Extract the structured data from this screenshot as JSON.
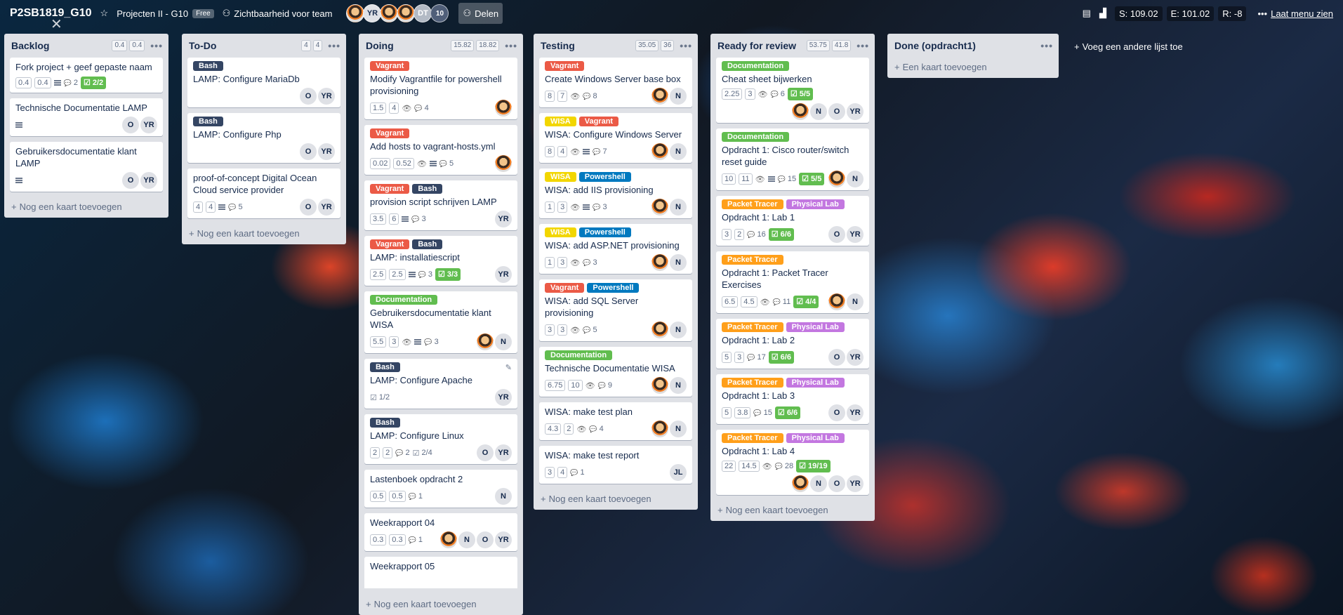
{
  "header": {
    "board_name": "P2SB1819_G10",
    "team": "Projecten II - G10",
    "free_badge": "Free",
    "visibility": "Zichtbaarheid voor team",
    "avatars": [
      "YR",
      "DT",
      "10"
    ],
    "share": "Delen",
    "stats": {
      "s": "S: 109.02",
      "e": "E: 101.02",
      "r": "R: -8"
    },
    "menu": "Laat menu zien"
  },
  "add_list": "Voeg een andere lijst toe",
  "add_card": "Nog een kaart toevoegen",
  "add_card_first": "Een kaart toevoegen",
  "colors": {
    "vagrant": "#eb5a46",
    "bash": "#344563",
    "documentation": "#61bd4f",
    "wisa": "#f2d600",
    "powershell": "#0079bf",
    "packet_tracer": "#ff9f1a",
    "physical_lab": "#c377e0"
  },
  "lists": [
    {
      "title": "Backlog",
      "est": [
        "0.4",
        "0.4"
      ],
      "cards": [
        {
          "labels": [],
          "title": "Fork project + geef gepaste naam",
          "nums": [
            "0.4",
            "0.4"
          ],
          "desc": true,
          "comments": "2",
          "check": "2/2",
          "members": []
        },
        {
          "labels": [],
          "title": "Technische Documentatie LAMP",
          "nums": [],
          "desc": true,
          "members": [
            "O",
            "YR"
          ]
        },
        {
          "labels": [],
          "title": "Gebruikersdocumentatie klant LAMP",
          "nums": [],
          "desc": true,
          "members": [
            "O",
            "YR"
          ]
        }
      ]
    },
    {
      "title": "To-Do",
      "est": [
        "4",
        "4"
      ],
      "cards": [
        {
          "labels": [
            "Bash"
          ],
          "title": "LAMP: Configure MariaDb",
          "nums": [],
          "members": [
            "O",
            "YR"
          ]
        },
        {
          "labels": [
            "Bash"
          ],
          "title": "LAMP: Configure Php",
          "nums": [],
          "members": [
            "O",
            "YR"
          ]
        },
        {
          "labels": [],
          "title": "proof-of-concept Digital Ocean Cloud service provider",
          "nums": [
            "4",
            "4"
          ],
          "desc": true,
          "comments": "5",
          "members": [
            "O",
            "YR"
          ]
        }
      ]
    },
    {
      "title": "Doing",
      "est": [
        "15.82",
        "18.82"
      ],
      "cards": [
        {
          "labels": [
            "Vagrant"
          ],
          "title": "Modify Vagrantfile for powershell provisioning",
          "nums": [
            "1.5",
            "4"
          ],
          "watch": true,
          "comments": "4",
          "members": [
            "photo"
          ]
        },
        {
          "labels": [
            "Vagrant"
          ],
          "title": "Add hosts to vagrant-hosts.yml",
          "nums": [
            "0.02",
            "0.52"
          ],
          "watch": true,
          "desc": true,
          "comments": "5",
          "members": [
            "photo"
          ]
        },
        {
          "labels": [
            "Vagrant",
            "Bash"
          ],
          "title": "provision script schrijven LAMP",
          "nums": [
            "3.5",
            "6"
          ],
          "desc": true,
          "comments": "3",
          "members": [
            "YR"
          ]
        },
        {
          "labels": [
            "Vagrant",
            "Bash"
          ],
          "title": "LAMP: installatiescript",
          "nums": [
            "2.5",
            "2.5"
          ],
          "desc": true,
          "comments": "3",
          "check": "3/3",
          "members": [
            "YR"
          ]
        },
        {
          "labels": [
            "Documentation"
          ],
          "title": "Gebruikersdocumentatie klant WISA",
          "nums": [
            "5.5",
            "3"
          ],
          "watch": true,
          "desc": true,
          "comments": "3",
          "members": [
            "photo",
            "N"
          ]
        },
        {
          "labels": [
            "Bash"
          ],
          "title": "LAMP: Configure Apache",
          "nums": [],
          "checkplain": "1/2",
          "members": [
            "YR"
          ],
          "pencil": true
        },
        {
          "labels": [
            "Bash"
          ],
          "title": "LAMP: Configure Linux",
          "nums": [
            "2",
            "2"
          ],
          "comments": "2",
          "checkplain": "2/4",
          "members": [
            "O",
            "YR"
          ]
        },
        {
          "labels": [],
          "title": "Lastenboek opdracht 2",
          "nums": [
            "0.5",
            "0.5"
          ],
          "comments": "1",
          "members": [
            "N"
          ]
        },
        {
          "labels": [],
          "title": "Weekrapport 04",
          "nums": [
            "0.3",
            "0.3"
          ],
          "comments": "1",
          "members": [
            "photo",
            "N",
            "O",
            "YR"
          ]
        },
        {
          "labels": [],
          "title": "Weekrapport 05",
          "nums": [],
          "members": []
        }
      ]
    },
    {
      "title": "Testing",
      "est": [
        "35.05",
        "36"
      ],
      "cards": [
        {
          "labels": [
            "Vagrant"
          ],
          "title": "Create Windows Server base box",
          "nums": [
            "8",
            "7"
          ],
          "watch": true,
          "comments": "8",
          "members": [
            "photo",
            "N"
          ]
        },
        {
          "labels": [
            "WISA",
            "Vagrant"
          ],
          "title": "WISA: Configure Windows Server",
          "nums": [
            "8",
            "4"
          ],
          "watch": true,
          "desc": true,
          "comments": "7",
          "members": [
            "photo",
            "N"
          ]
        },
        {
          "labels": [
            "WISA",
            "Powershell"
          ],
          "title": "WISA: add IIS provisioning",
          "nums": [
            "1",
            "3"
          ],
          "watch": true,
          "desc": true,
          "comments": "3",
          "members": [
            "photo",
            "N"
          ]
        },
        {
          "labels": [
            "WISA",
            "Powershell"
          ],
          "title": "WISA: add ASP.NET provisioning",
          "nums": [
            "1",
            "3"
          ],
          "watch": true,
          "comments": "3",
          "members": [
            "photo",
            "N"
          ]
        },
        {
          "labels": [
            "Vagrant",
            "Powershell"
          ],
          "title": "WISA: add SQL Server provisioning",
          "nums": [
            "3",
            "3"
          ],
          "watch": true,
          "comments": "5",
          "members": [
            "photo",
            "N"
          ]
        },
        {
          "labels": [
            "Documentation"
          ],
          "title": "Technische Documentatie WISA",
          "nums": [
            "6.75",
            "10"
          ],
          "watch": true,
          "comments": "9",
          "members": [
            "photo",
            "N"
          ]
        },
        {
          "labels": [],
          "title": "WISA: make test plan",
          "nums": [
            "4.3",
            "2"
          ],
          "watch": true,
          "comments": "4",
          "members": [
            "photo",
            "N"
          ]
        },
        {
          "labels": [],
          "title": "WISA: make test report",
          "nums": [
            "3",
            "4"
          ],
          "comments": "1",
          "members": [
            "JL"
          ]
        }
      ]
    },
    {
      "title": "Ready for review",
      "est": [
        "53.75",
        "41.8"
      ],
      "cards": [
        {
          "labels": [
            "Documentation"
          ],
          "title": "Cheat sheet bijwerken",
          "nums": [
            "2.25",
            "3"
          ],
          "watch": true,
          "comments": "6",
          "check": "5/5",
          "members": [
            "photo",
            "N",
            "O",
            "YR"
          ]
        },
        {
          "labels": [
            "Documentation"
          ],
          "title": "Opdracht 1: Cisco router/switch reset guide",
          "nums": [
            "10",
            "11"
          ],
          "watch": true,
          "desc": true,
          "comments": "15",
          "check": "5/5",
          "members": [
            "photo",
            "N"
          ]
        },
        {
          "labels": [
            "Packet Tracer",
            "Physical Lab"
          ],
          "title": "Opdracht 1: Lab 1",
          "nums": [
            "3",
            "2"
          ],
          "comments": "16",
          "check": "6/6",
          "members": [
            "O",
            "YR"
          ]
        },
        {
          "labels": [
            "Packet Tracer"
          ],
          "title": "Opdracht 1: Packet Tracer Exercises",
          "nums": [
            "6.5",
            "4.5"
          ],
          "watch": true,
          "comments": "11",
          "check": "4/4",
          "members": [
            "photo",
            "N"
          ]
        },
        {
          "labels": [
            "Packet Tracer",
            "Physical Lab"
          ],
          "title": "Opdracht 1: Lab 2",
          "nums": [
            "5",
            "3"
          ],
          "comments": "17",
          "check": "6/6",
          "members": [
            "O",
            "YR"
          ]
        },
        {
          "labels": [
            "Packet Tracer",
            "Physical Lab"
          ],
          "title": "Opdracht 1: Lab 3",
          "nums": [
            "5",
            "3.8"
          ],
          "comments": "15",
          "check": "6/6",
          "members": [
            "O",
            "YR"
          ]
        },
        {
          "labels": [
            "Packet Tracer",
            "Physical Lab"
          ],
          "title": "Opdracht 1: Lab 4",
          "nums": [
            "22",
            "14.5"
          ],
          "watch": true,
          "comments": "28",
          "check": "19/19",
          "members": [
            "photo",
            "N",
            "O",
            "YR"
          ]
        }
      ]
    },
    {
      "title": "Done (opdracht1)",
      "est": [],
      "cards": []
    }
  ]
}
